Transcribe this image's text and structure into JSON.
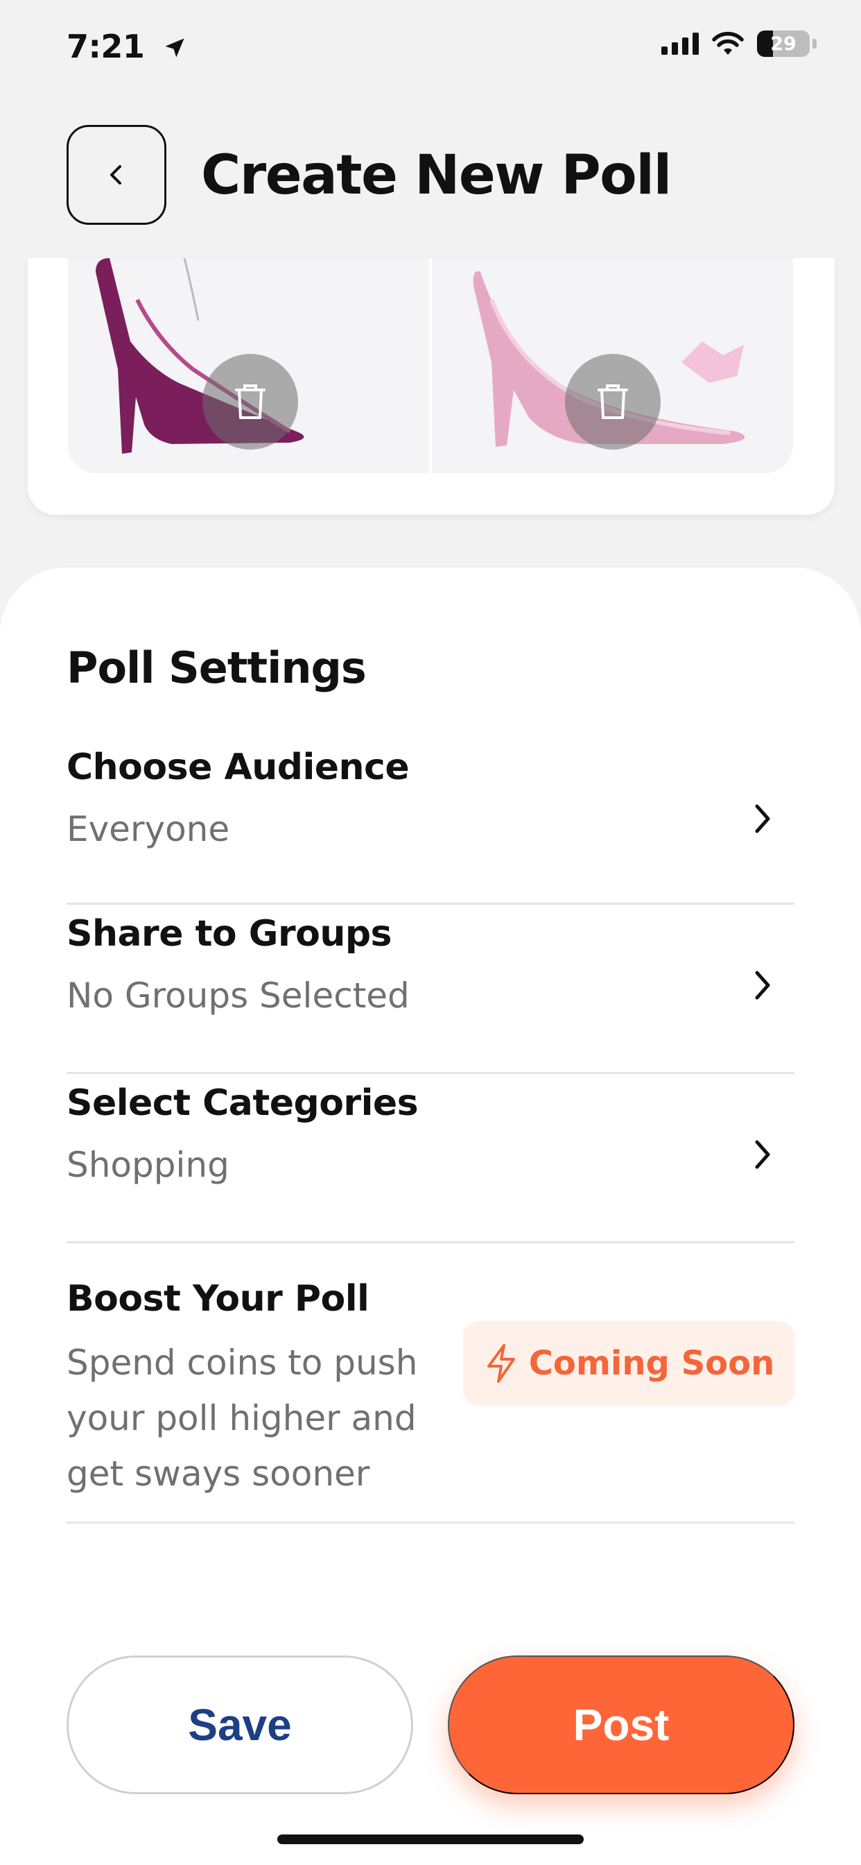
{
  "status_bar": {
    "time": "7:21",
    "battery": "29"
  },
  "header": {
    "title": "Create New Poll"
  },
  "image_options": [
    {
      "name": "option-image-1",
      "shoe_color": "#7a1f5c"
    },
    {
      "name": "option-image-2",
      "shoe_color": "#e6a9c4"
    }
  ],
  "settings": {
    "title": "Poll Settings",
    "audience": {
      "title": "Choose Audience",
      "value": "Everyone"
    },
    "groups": {
      "title": "Share to Groups",
      "value": "No Groups Selected"
    },
    "categories": {
      "title": "Select Categories",
      "value": "Shopping"
    },
    "boost": {
      "title": "Boost Your Poll",
      "description": "Spend coins to push your poll higher and get sways sooner",
      "badge": "Coming Soon"
    }
  },
  "actions": {
    "save": "Save",
    "post": "Post"
  },
  "colors": {
    "accent": "#ff6637",
    "save_text": "#1e3f86",
    "badge_bg": "#fff1ea"
  },
  "icons": {
    "status": [
      "location-arrow-icon",
      "signal-icon",
      "wifi-icon",
      "battery-icon"
    ],
    "header": [
      "chevron-left-icon"
    ],
    "images": [
      "trash-icon"
    ],
    "settings": [
      "chevron-right-icon",
      "lightning-icon"
    ]
  }
}
